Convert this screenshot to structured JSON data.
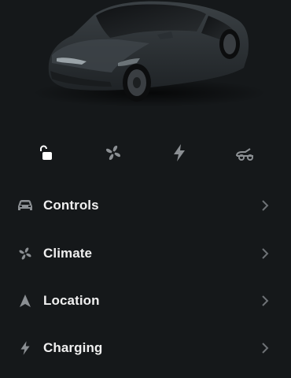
{
  "vehicle": {
    "image_icon": "car-render",
    "paint_color": "#2d3236"
  },
  "quick_controls": [
    {
      "name": "lock-toggle",
      "icon": "unlock-icon",
      "state": "unlocked"
    },
    {
      "name": "climate-quick",
      "icon": "fan-icon"
    },
    {
      "name": "charge-quick",
      "icon": "bolt-icon"
    },
    {
      "name": "trunk-quick",
      "icon": "frunk-icon"
    }
  ],
  "menu": {
    "items": [
      {
        "label": "Controls",
        "icon": "car-icon"
      },
      {
        "label": "Climate",
        "icon": "fan-icon"
      },
      {
        "label": "Location",
        "icon": "navigation-arrow-icon"
      },
      {
        "label": "Charging",
        "icon": "bolt-icon"
      }
    ]
  },
  "colors": {
    "background": "#15181a",
    "text": "#f0f0f0",
    "icon_muted": "#8b8f93",
    "icon_active": "#ffffff",
    "chevron": "#6e7276"
  }
}
